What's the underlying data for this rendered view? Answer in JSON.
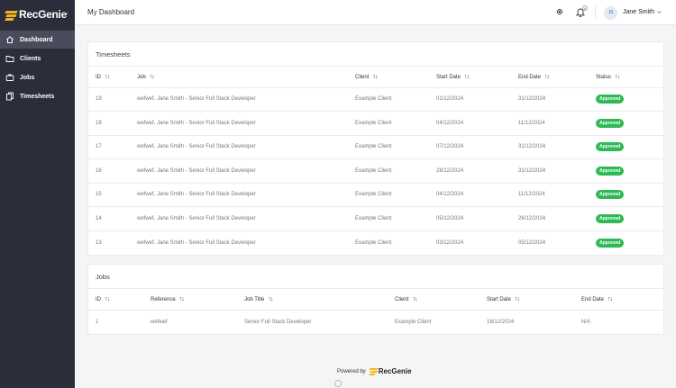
{
  "brand": {
    "name": "RecGenie",
    "mark": "."
  },
  "sidebar": {
    "items": [
      {
        "label": "Dashboard",
        "icon": "home-icon",
        "active": true
      },
      {
        "label": "Clients",
        "icon": "folder-icon",
        "active": false
      },
      {
        "label": "Jobs",
        "icon": "briefcase-icon",
        "active": false
      },
      {
        "label": "Timesheets",
        "icon": "documents-icon",
        "active": false
      }
    ]
  },
  "header": {
    "title": "My Dashboard",
    "notification_count": "0",
    "user": {
      "initials": "JS",
      "name": "Jane Smith"
    }
  },
  "timesheets": {
    "title": "Timesheets",
    "columns": [
      "ID",
      "Job",
      "Client",
      "Start Date",
      "End Date",
      "Status"
    ],
    "rows": [
      {
        "id": "19",
        "job": "wefwef, Jane Smith - Senior Full Stack Developer",
        "client": "Example Client",
        "start": "01/12/2024",
        "end": "31/12/2024",
        "status": "Approved"
      },
      {
        "id": "18",
        "job": "wefwef, Jane Smith - Senior Full Stack Developer",
        "client": "Example Client",
        "start": "04/12/2024",
        "end": "11/12/2024",
        "status": "Approved"
      },
      {
        "id": "17",
        "job": "wefwef, Jane Smith - Senior Full Stack Developer",
        "client": "Example Client",
        "start": "07/12/2024",
        "end": "31/12/2024",
        "status": "Approved"
      },
      {
        "id": "16",
        "job": "wefwef, Jane Smith - Senior Full Stack Developer",
        "client": "Example Client",
        "start": "28/12/2024",
        "end": "31/12/2024",
        "status": "Approved"
      },
      {
        "id": "15",
        "job": "wefwef, Jane Smith - Senior Full Stack Developer",
        "client": "Example Client",
        "start": "04/12/2024",
        "end": "11/12/2024",
        "status": "Approved"
      },
      {
        "id": "14",
        "job": "wefwef, Jane Smith - Senior Full Stack Developer",
        "client": "Example Client",
        "start": "05/12/2024",
        "end": "26/12/2024",
        "status": "Approved"
      },
      {
        "id": "13",
        "job": "wefwef, Jane Smith - Senior Full Stack Developer",
        "client": "Example Client",
        "start": "03/12/2024",
        "end": "05/12/2024",
        "status": "Approved"
      }
    ]
  },
  "jobs": {
    "title": "Jobs",
    "columns": [
      "ID",
      "Reference",
      "Job Title",
      "Client",
      "Start Date",
      "End Date"
    ],
    "rows": [
      {
        "id": "1",
        "reference": "wefwef",
        "title": "Senior Full Stack Developer",
        "client": "Example Client",
        "start": "16/12/2024",
        "end": "N/A"
      }
    ]
  },
  "footer": {
    "powered_by": "Powered by",
    "brand": "RecGenie"
  },
  "colors": {
    "sidebar": "#2b2d3b",
    "accent": "#f5b41a",
    "approved": "#2dba55"
  }
}
